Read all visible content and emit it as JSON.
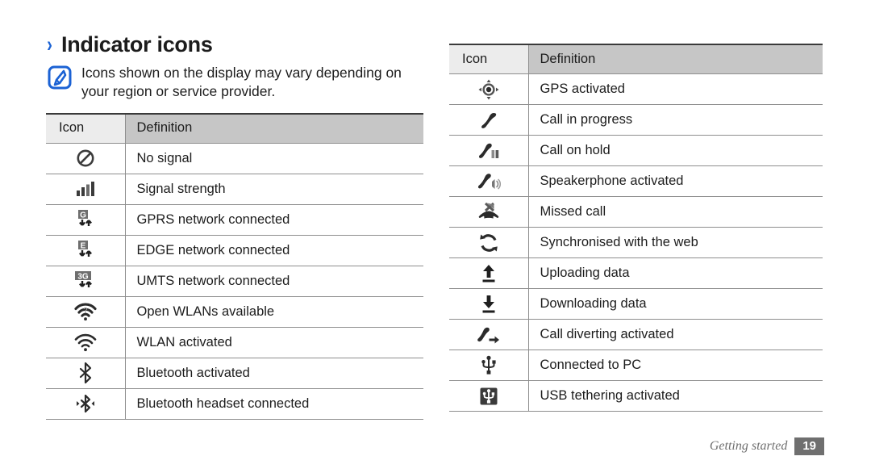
{
  "heading": {
    "chevron": "›",
    "title": "Indicator icons"
  },
  "note": {
    "icon": "note-pen-icon",
    "text": "Icons shown on the display may vary depending on your region or service provider."
  },
  "tables": {
    "left": {
      "headers": {
        "icon": "Icon",
        "definition": "Definition"
      },
      "rows": [
        {
          "icon": "no-signal-icon",
          "definition": "No signal"
        },
        {
          "icon": "signal-strength-icon",
          "definition": "Signal strength"
        },
        {
          "icon": "gprs-network-icon",
          "definition": "GPRS network connected"
        },
        {
          "icon": "edge-network-icon",
          "definition": "EDGE network connected"
        },
        {
          "icon": "umts-network-icon",
          "definition": "UMTS network connected"
        },
        {
          "icon": "open-wlan-icon",
          "definition": "Open WLANs available"
        },
        {
          "icon": "wlan-activated-icon",
          "definition": "WLAN activated"
        },
        {
          "icon": "bluetooth-activated-icon",
          "definition": "Bluetooth activated"
        },
        {
          "icon": "bluetooth-headset-icon",
          "definition": "Bluetooth headset connected"
        }
      ]
    },
    "right": {
      "headers": {
        "icon": "Icon",
        "definition": "Definition"
      },
      "rows": [
        {
          "icon": "gps-activated-icon",
          "definition": "GPS activated"
        },
        {
          "icon": "call-in-progress-icon",
          "definition": "Call in progress"
        },
        {
          "icon": "call-on-hold-icon",
          "definition": "Call on hold"
        },
        {
          "icon": "speakerphone-icon",
          "definition": "Speakerphone activated"
        },
        {
          "icon": "missed-call-icon",
          "definition": "Missed call"
        },
        {
          "icon": "sync-web-icon",
          "definition": "Synchronised with the web"
        },
        {
          "icon": "upload-data-icon",
          "definition": "Uploading data"
        },
        {
          "icon": "download-data-icon",
          "definition": "Downloading data"
        },
        {
          "icon": "call-diverting-icon",
          "definition": "Call diverting activated"
        },
        {
          "icon": "usb-connected-icon",
          "definition": "Connected to PC"
        },
        {
          "icon": "usb-tethering-icon",
          "definition": "USB tethering activated"
        }
      ]
    }
  },
  "footer": {
    "label": "Getting started",
    "page": "19"
  },
  "colors": {
    "accent_blue": "#1b62d4",
    "header_icon_bg": "#ececec",
    "header_def_bg": "#c6c6c6",
    "rule": "#8e8e8e",
    "footer_grey": "#6f6f6f",
    "text": "#1c1c1c"
  }
}
